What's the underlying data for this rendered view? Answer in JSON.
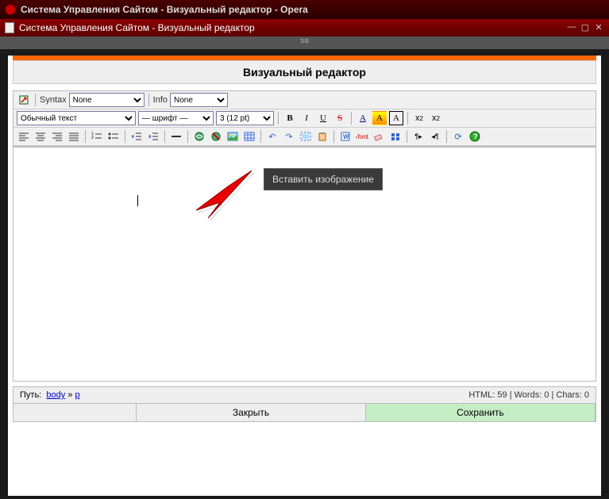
{
  "browser": {
    "title": "Система Управления Сайтом - Визуальный редактор - Opera"
  },
  "document": {
    "title": "Система Управления Сайтом - Визуальный редактор"
  },
  "sa": "sa",
  "header": "Визуальный редактор",
  "toolbar1": {
    "syntax_label": "Syntax",
    "syntax_value": "None",
    "info_label": "Info",
    "info_value": "None"
  },
  "toolbar2": {
    "format": "Обычный текст",
    "font": "— шрифт —",
    "size": "3 (12 pt)",
    "b": "B",
    "i": "I",
    "u": "U",
    "s": "S",
    "a_color": "A",
    "a_bg": "A",
    "a_box": "A",
    "x2": "x",
    "x2s": "2"
  },
  "tooltip": "Вставить изображение",
  "status": {
    "path_label": "Путь:",
    "body": "body",
    "sep": "»",
    "p": "p",
    "html": "HTML: 59",
    "words": "Words: 0",
    "chars": "Chars: 0"
  },
  "buttons": {
    "close": "Закрыть",
    "save": "Сохранить"
  }
}
